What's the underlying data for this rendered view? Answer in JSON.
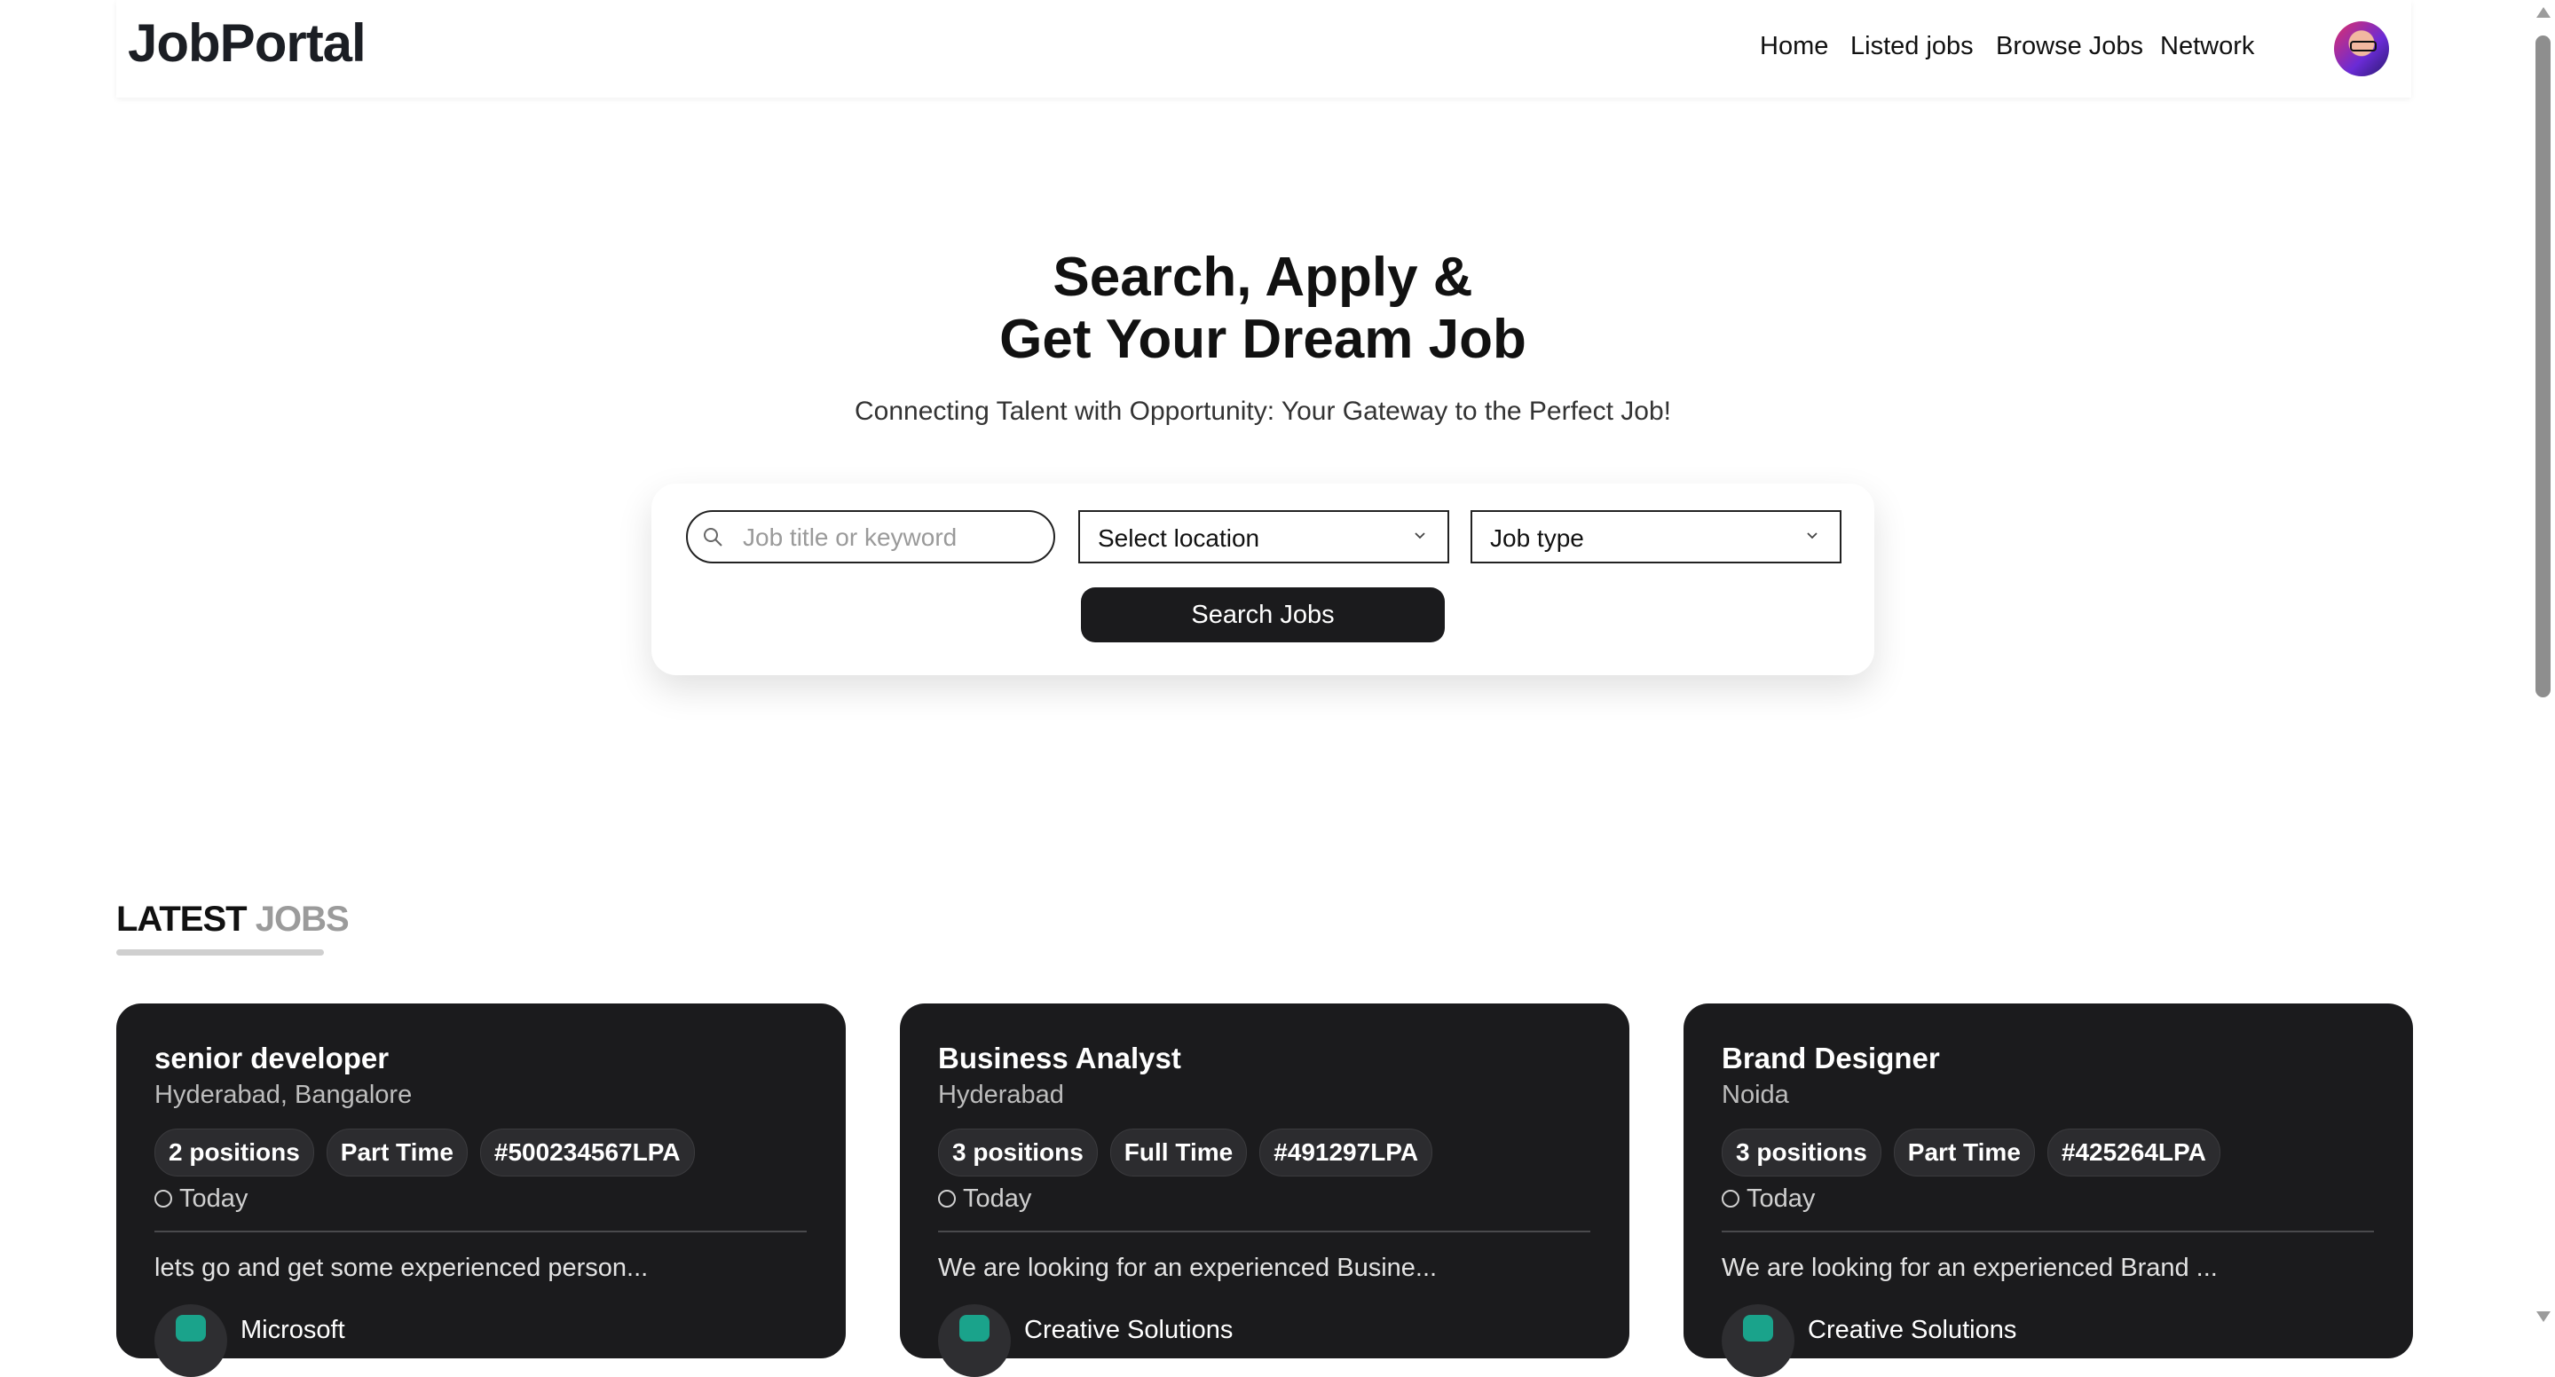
{
  "header": {
    "logo": "JobPortal",
    "nav": [
      "Home",
      "Listed jobs",
      "Browse Jobs",
      "Network"
    ]
  },
  "hero": {
    "title_line1": "Search, Apply &",
    "title_line2": "Get Your Dream Job",
    "subtitle": "Connecting Talent with Opportunity: Your Gateway to the Perfect Job!"
  },
  "search": {
    "keyword_placeholder": "Job title or keyword",
    "location_value": "Select location",
    "jobtype_value": "Job type",
    "button_label": "Search Jobs"
  },
  "latest": {
    "title_main": "LATEST",
    "title_muted": "JOBS"
  },
  "jobs": [
    {
      "title": "senior developer",
      "location": "Hyderabad, Bangalore",
      "positions": "2 positions",
      "type": "Part Time",
      "salary": "#500234567LPA",
      "posted": "Today",
      "description": "lets go and get some experienced person...",
      "company": "Microsoft"
    },
    {
      "title": "Business Analyst",
      "location": "Hyderabad",
      "positions": "3 positions",
      "type": "Full Time",
      "salary": "#491297LPA",
      "posted": "Today",
      "description": "We are looking for an experienced Busine...",
      "company": "Creative Solutions"
    },
    {
      "title": "Brand Designer",
      "location": "Noida",
      "positions": "3 positions",
      "type": "Part Time",
      "salary": "#425264LPA",
      "posted": "Today",
      "description": "We are looking for an experienced Brand ...",
      "company": "Creative Solutions"
    }
  ]
}
